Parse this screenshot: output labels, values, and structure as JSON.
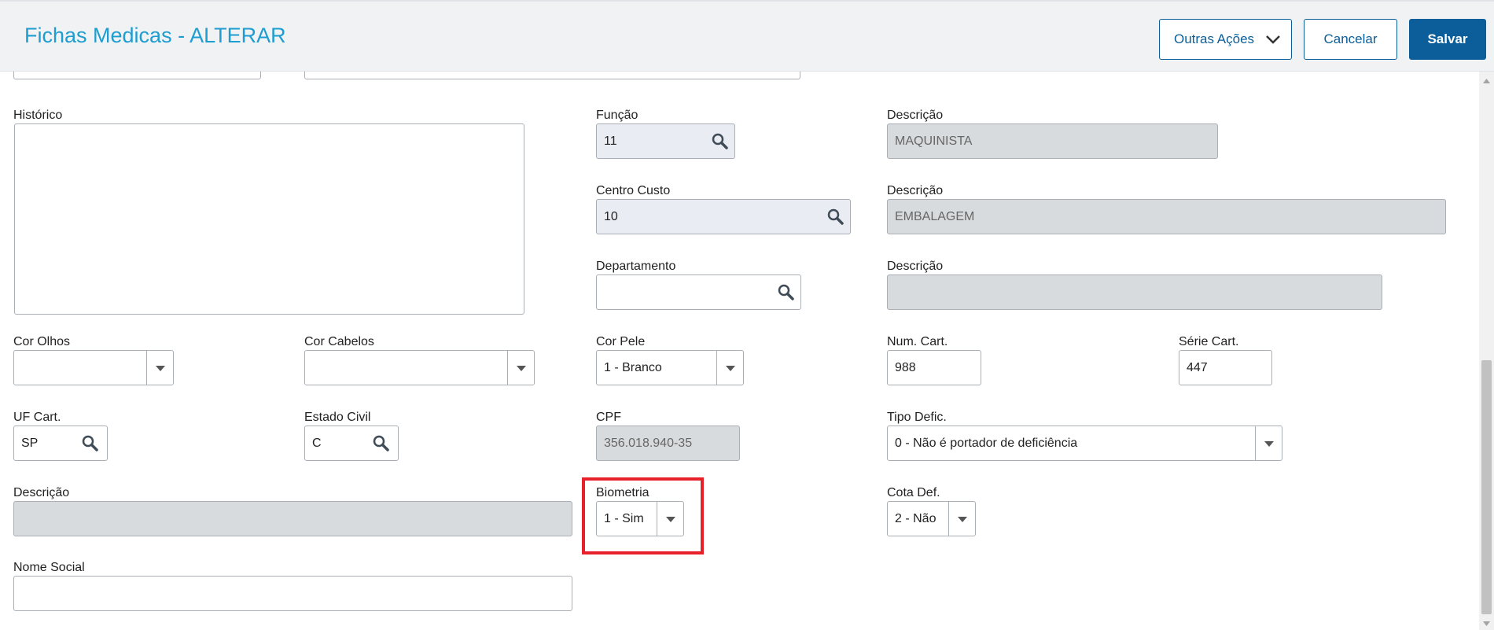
{
  "header": {
    "title": "Fichas Medicas - ALTERAR",
    "other_actions_label": "Outras Ações",
    "cancel_label": "Cancelar",
    "save_label": "Salvar"
  },
  "form": {
    "historico": {
      "label": "Histórico",
      "value": ""
    },
    "funcao": {
      "label": "Função",
      "value": "11"
    },
    "funcao_desc": {
      "label": "Descrição",
      "value": "MAQUINISTA"
    },
    "centro_custo": {
      "label": "Centro Custo",
      "value": "10"
    },
    "centro_custo_desc": {
      "label": "Descrição",
      "value": "EMBALAGEM"
    },
    "departamento": {
      "label": "Departamento",
      "value": ""
    },
    "departamento_desc": {
      "label": "Descrição",
      "value": ""
    },
    "cor_olhos": {
      "label": "Cor Olhos",
      "value": ""
    },
    "cor_cabelos": {
      "label": "Cor Cabelos",
      "value": ""
    },
    "cor_pele": {
      "label": "Cor Pele",
      "value": "1 - Branco"
    },
    "num_cart": {
      "label": "Num. Cart.",
      "value": "988"
    },
    "serie_cart": {
      "label": "Série Cart.",
      "value": "447"
    },
    "uf_cart": {
      "label": "UF Cart.",
      "value": "SP"
    },
    "estado_civil": {
      "label": "Estado Civil",
      "value": "C"
    },
    "cpf": {
      "label": "CPF",
      "value": "356.018.940-35"
    },
    "tipo_defic": {
      "label": "Tipo Defic.",
      "value": "0 - Não é portador de deficiência"
    },
    "descricao": {
      "label": "Descrição",
      "value": ""
    },
    "biometria": {
      "label": "Biometria",
      "value": "1 - Sim"
    },
    "cota_def": {
      "label": "Cota Def.",
      "value": "2 - Não"
    },
    "nome_social": {
      "label": "Nome Social",
      "value": ""
    }
  },
  "colors": {
    "title": "#1d9dd0",
    "primary": "#0b5e99",
    "highlight": "#e8202a",
    "readonly_bg": "#d8dbdd",
    "lookup_bg": "#e9edf3"
  },
  "icons": [
    "chevron-down-icon",
    "search-icon",
    "dropdown-arrow-icon",
    "scroll-up-icon",
    "scroll-down-icon"
  ]
}
